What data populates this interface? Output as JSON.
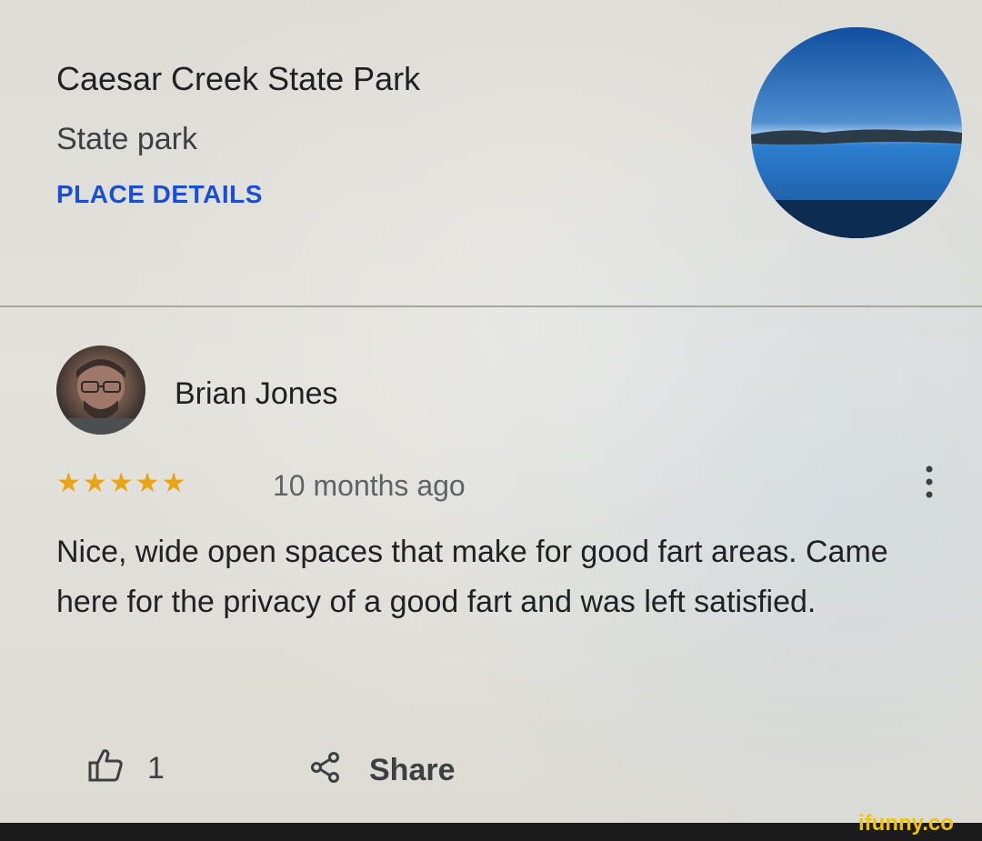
{
  "place": {
    "title": "Caesar Creek State Park",
    "subtitle": "State park",
    "details_label": "PLACE DETAILS"
  },
  "review": {
    "reviewer_name": "Brian Jones",
    "rating": 5,
    "rating_display": "★★★★★",
    "time": "10 months ago",
    "text": "Nice, wide open spaces that make for good fart areas. Came here for the privacy of a good fart and was left satisfied.",
    "likes": "1",
    "share_label": "Share"
  },
  "colors": {
    "accent_blue": "#1a4fd3",
    "star_gold": "#e8a417"
  },
  "icons": {
    "like": "thumbs-up-icon",
    "share": "share-icon",
    "more": "more-vert-icon"
  },
  "watermark": {
    "text": "ifunny.co"
  }
}
